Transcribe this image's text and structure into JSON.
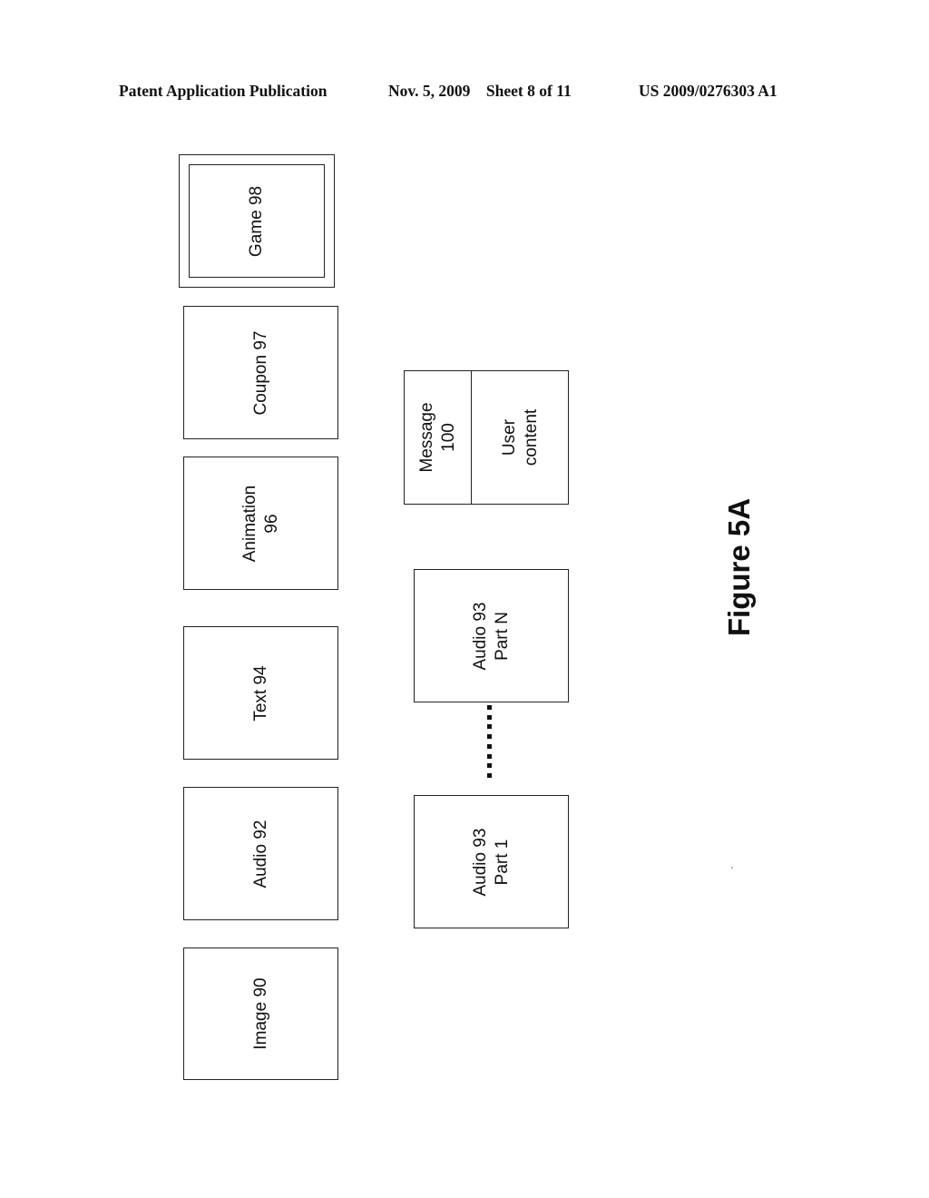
{
  "header": {
    "left": "Patent Application Publication",
    "date_sheet": "Nov. 5, 2009    Sheet 8 of 11",
    "number": "US 2009/0276303 A1"
  },
  "column_a": [
    {
      "id": "game-98",
      "lines": [
        "Game 98"
      ],
      "double_border": true
    },
    {
      "id": "coupon-97",
      "lines": [
        "Coupon 97"
      ]
    },
    {
      "id": "animation-96",
      "lines": [
        "Animation",
        "96"
      ]
    },
    {
      "id": "text-94",
      "lines": [
        "Text 94"
      ]
    },
    {
      "id": "audio-92",
      "lines": [
        "Audio 92"
      ]
    },
    {
      "id": "image-90",
      "lines": [
        "Image 90"
      ]
    }
  ],
  "message": {
    "left_lines": [
      "Message",
      "100"
    ],
    "right_lines": [
      "User",
      "content"
    ]
  },
  "audio_parts": {
    "part_n": [
      "Audio 93",
      "Part N"
    ],
    "part_1": [
      "Audio 93",
      "Part 1"
    ],
    "ellipsis_dots": 8
  },
  "figure_label": "Figure 5A"
}
